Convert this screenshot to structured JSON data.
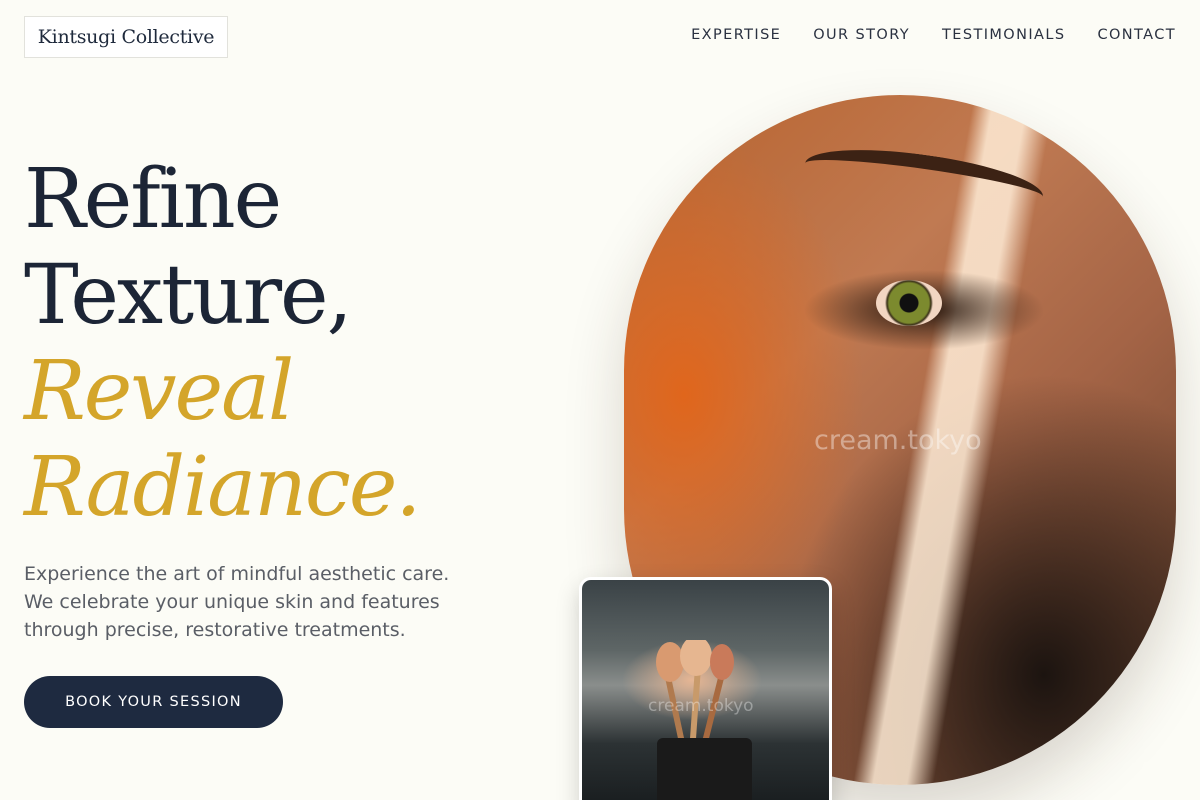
{
  "header": {
    "logo": "Kintsugi Collective",
    "nav": [
      "EXPERTISE",
      "OUR STORY",
      "TESTIMONIALS",
      "CONTACT"
    ]
  },
  "hero": {
    "headline_line1": "Refine",
    "headline_line2": "Texture,",
    "headline_line3": "Reveal",
    "headline_line4": "Radiance.",
    "subtext_line1": "Experience the art of mindful aesthetic care.",
    "subtext_line2": "We celebrate your unique skin and features",
    "subtext_line3": "through precise, restorative treatments.",
    "cta": "BOOK YOUR SESSION"
  },
  "images": {
    "main_watermark": "cream.tokyo",
    "card_watermark": "cream.tokyo"
  },
  "colors": {
    "background": "#fcfcf6",
    "navy": "#1e2a40",
    "gold": "#d4a52a"
  }
}
